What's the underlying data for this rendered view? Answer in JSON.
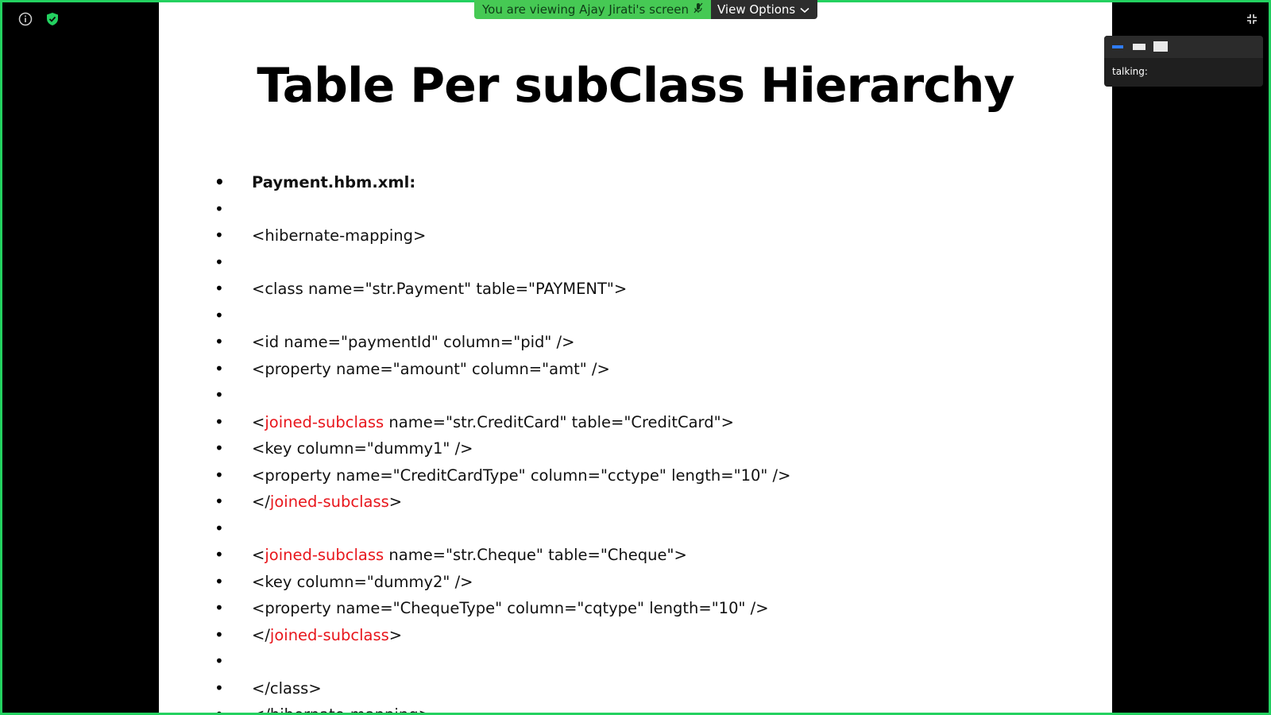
{
  "share_banner": {
    "viewing_text": "You are viewing Ajay Jirati's screen",
    "view_options_label": "View Options"
  },
  "talk_panel": {
    "talking_label": "talking:"
  },
  "slide": {
    "title": "Table Per subClass Hierarchy",
    "lines": [
      {
        "text": "Payment.hbm.xml:",
        "bold": true
      },
      {
        "text": ""
      },
      {
        "text": "<hibernate-mapping>"
      },
      {
        "text": ""
      },
      {
        "text": "<class name=\"str.Payment\" table=\"PAYMENT\">"
      },
      {
        "text": ""
      },
      {
        "text": "<id name=\"paymentId\" column=\"pid\" />"
      },
      {
        "text": "<property name=\"amount\" column=\"amt\" />"
      },
      {
        "text": ""
      },
      {
        "pre": "<",
        "kw": "joined-subclass",
        "post": " name=\"str.CreditCard\" table=\"CreditCard\">"
      },
      {
        "text": "<key column=\"dummy1\" />"
      },
      {
        "text": "<property name=\"CreditCardType\" column=\"cctype\" length=\"10\" />"
      },
      {
        "pre": "</",
        "kw": "joined-subclass",
        "post": ">"
      },
      {
        "text": ""
      },
      {
        "pre": "<",
        "kw": "joined-subclass",
        "post": " name=\"str.Cheque\" table=\"Cheque\">"
      },
      {
        "text": "<key column=\"dummy2\" />"
      },
      {
        "text": "<property name=\"ChequeType\" column=\"cqtype\" length=\"10\" />"
      },
      {
        "pre": "</",
        "kw": "joined-subclass",
        "post": ">"
      },
      {
        "text": ""
      },
      {
        "text": "</class>"
      },
      {
        "text": "</hibernate-mapping>"
      }
    ]
  },
  "colors": {
    "frame": "#23d160",
    "keyword": "#e8161c",
    "banner_green": "#46c954"
  },
  "icons": [
    "info-icon",
    "shield-check-icon",
    "mute-icon",
    "chevron-down-icon",
    "exit-fullscreen-icon",
    "minimize-icon",
    "speaker-view-icon",
    "gallery-view-icon"
  ]
}
